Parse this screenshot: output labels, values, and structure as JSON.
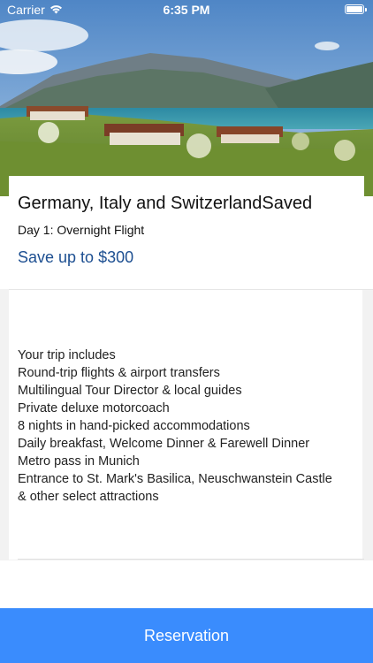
{
  "status_bar": {
    "carrier": "Carrier",
    "time": "6:35 PM"
  },
  "trip": {
    "title": "Germany, Italy and SwitzerlandSaved",
    "day": "Day 1: Overnight Flight",
    "promo": "Save up to $300"
  },
  "includes": {
    "lines": [
      "Your trip includes",
      "Round-trip flights & airport transfers",
      "Multilingual Tour Director & local guides",
      "Private deluxe motorcoach",
      "8 nights in hand-picked accommodations",
      "Daily breakfast, Welcome Dinner & Farewell Dinner",
      "Metro pass in Munich",
      "Entrance to St. Mark's Basilica, Neuschwanstein Castle",
      "& other select attractions"
    ]
  },
  "actions": {
    "reserve_label": "Reservation"
  },
  "colors": {
    "accent": "#3a8cfd",
    "promo": "#1d4f91"
  }
}
